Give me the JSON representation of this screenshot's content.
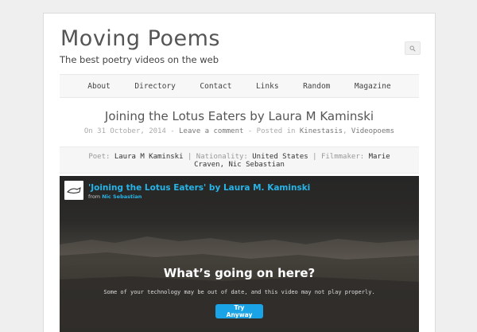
{
  "site": {
    "title": "Moving Poems",
    "tagline": "The best poetry videos on the web",
    "search_icon": "search-icon"
  },
  "nav": {
    "items": [
      {
        "label": "About"
      },
      {
        "label": "Directory"
      },
      {
        "label": "Contact"
      },
      {
        "label": "Links"
      },
      {
        "label": "Random"
      },
      {
        "label": "Magazine"
      }
    ]
  },
  "post": {
    "title": "Joining the Lotus Eaters by Laura M Kaminski",
    "meta": {
      "prefix": "On",
      "date": "31 October, 2014",
      "sep1": " - ",
      "comment": "Leave a comment",
      "sep2": " - Posted in ",
      "category1": "Kinestasis",
      "comma": ", ",
      "category2": "Videopoems"
    },
    "credits": {
      "poet_label": "Poet:",
      "poet": "Laura M Kaminski",
      "sep1": "|",
      "nationality_label": "Nationality:",
      "nationality": "United States",
      "sep2": "|",
      "filmmaker_label": "Filmmaker:",
      "filmmaker": "Marie Craven, Nic Sebastian"
    }
  },
  "video": {
    "title": "'Joining the Lotus Eaters' by Laura M. Kaminski",
    "from_label": "from",
    "author": "Nic Sebastian",
    "heading": "What’s going on here?",
    "message": "Some of your technology may be out of date, and this video may not play properly.",
    "button_label": "Try Anyway",
    "colors": {
      "link": "#27b4e8",
      "button": "#1aa3e6"
    }
  }
}
